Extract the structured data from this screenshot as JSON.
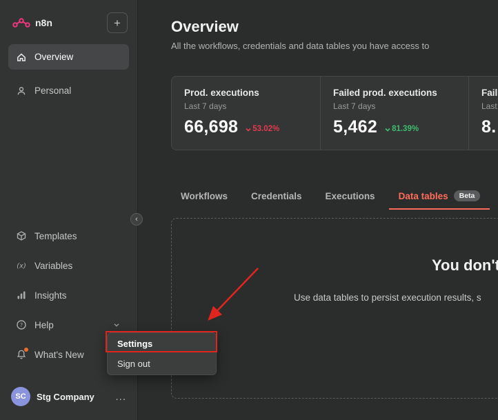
{
  "sidebar": {
    "logo_text": "n8n",
    "add_button": "+",
    "items": [
      {
        "label": "Overview",
        "active": true
      },
      {
        "label": "Personal",
        "active": false
      }
    ],
    "secondary_items": [
      {
        "label": "Templates"
      },
      {
        "label": "Variables"
      },
      {
        "label": "Insights"
      },
      {
        "label": "Help"
      },
      {
        "label": "What's New"
      }
    ],
    "user": {
      "initials": "SC",
      "name": "Stg Company",
      "more": "..."
    }
  },
  "menu": {
    "items": [
      {
        "label": "Settings"
      },
      {
        "label": "Sign out"
      }
    ]
  },
  "main": {
    "title": "Overview",
    "subtitle": "All the workflows, credentials and data tables you have access to",
    "stats": [
      {
        "title": "Prod. executions",
        "period": "Last 7 days",
        "value": "66,698",
        "delta": "53.02%",
        "trend": "down",
        "trend_color": "#e23a52"
      },
      {
        "title": "Failed prod. executions",
        "period": "Last 7 days",
        "value": "5,462",
        "delta": "81.39%",
        "trend": "down",
        "trend_color": "#3dbb6e"
      },
      {
        "title": "Fail",
        "period": "Last",
        "value": "8."
      }
    ],
    "tabs": [
      {
        "label": "Workflows"
      },
      {
        "label": "Credentials"
      },
      {
        "label": "Executions"
      },
      {
        "label": "Data tables",
        "active": true,
        "badge": "Beta"
      }
    ],
    "empty_state": {
      "heading": "You don't h",
      "description": "Use data tables to persist execution results, s"
    }
  },
  "colors": {
    "accent": "#ff6d5a",
    "brand_pink": "#f0367e",
    "negative": "#e23a52",
    "positive": "#3dbb6e",
    "annotation": "#e0251f",
    "notification_dot": "#ed6d2d",
    "avatar_bg": "#8a94dd"
  }
}
